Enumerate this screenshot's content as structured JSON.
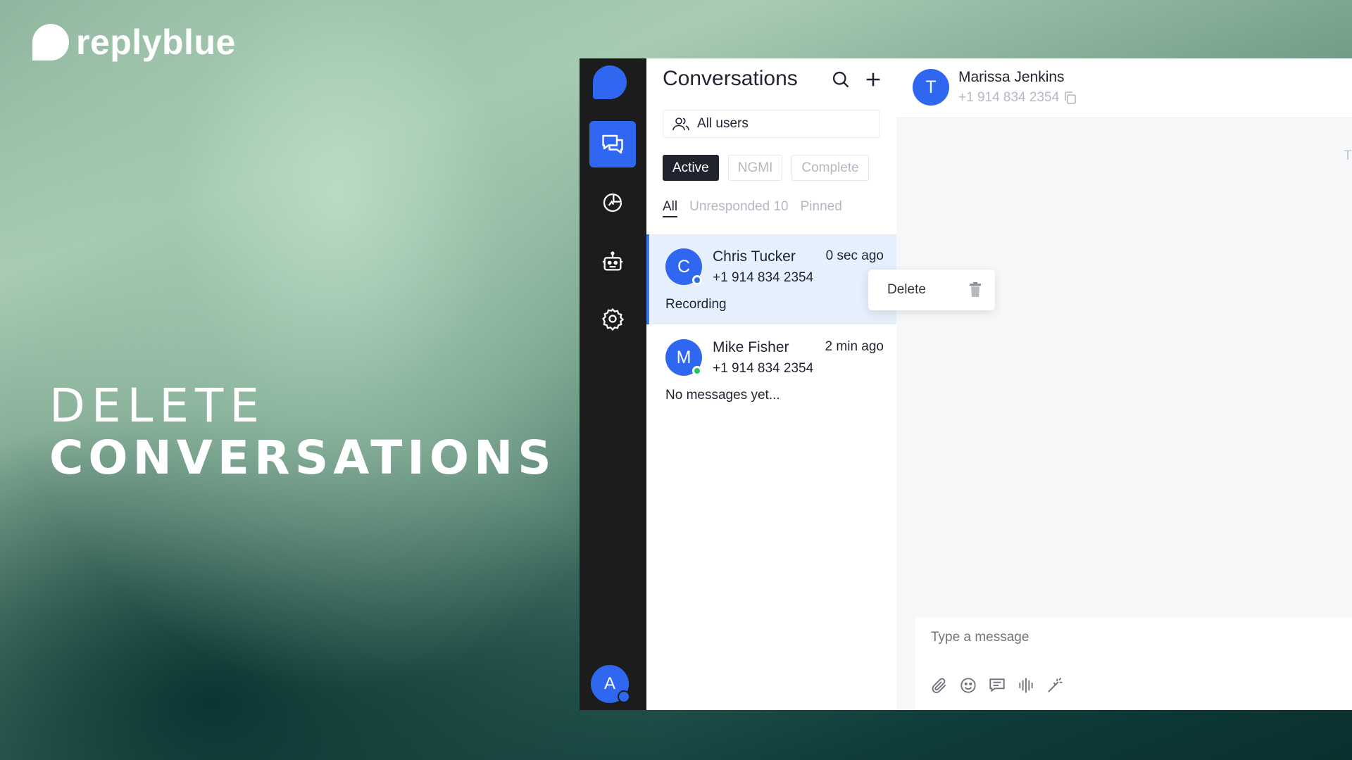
{
  "brand": {
    "name": "replyblue"
  },
  "headline": {
    "line1": "DELETE",
    "line2": "CONVERSATIONS"
  },
  "colors": {
    "accent": "#2f67f0",
    "rail": "#1c1c1c",
    "online": "#22c55e",
    "selected_bg": "#e6f0fc"
  },
  "rail": {
    "items": [
      {
        "icon": "chat-bubbles-icon",
        "active": true
      },
      {
        "icon": "analytics-pie-icon",
        "active": false
      },
      {
        "icon": "robot-icon",
        "active": false
      },
      {
        "icon": "gear-icon",
        "active": false
      }
    ],
    "avatar_initial": "A"
  },
  "conversations_panel": {
    "title": "Conversations",
    "user_filter": "All users",
    "status_tabs": [
      "Active",
      "NGMI",
      "Complete"
    ],
    "active_status": "Active",
    "sub_tabs": [
      "All",
      "Unresponded 10",
      "Pinned"
    ],
    "active_sub_tab": "All",
    "items": [
      {
        "initial": "C",
        "name": "Chris Tucker",
        "time": "0 sec ago",
        "phone": "+1 914 834 2354",
        "preview": "Recording",
        "presence": "blue",
        "selected": true
      },
      {
        "initial": "M",
        "name": "Mike Fisher",
        "time": "2 min ago",
        "phone": "+1 914 834 2354",
        "preview": "No messages yet...",
        "presence": "green",
        "selected": false
      }
    ]
  },
  "context_menu": {
    "label": "Delete",
    "icon": "trash-icon"
  },
  "chat": {
    "contact_initial": "T",
    "contact_name": "Marissa Jenkins",
    "contact_phone": "+1 914 834 2354",
    "edge_letter": "T",
    "composer_placeholder": "Type a message",
    "tools": [
      "paperclip-icon",
      "emoji-icon",
      "template-icon",
      "voice-icon",
      "magic-wand-icon"
    ]
  }
}
